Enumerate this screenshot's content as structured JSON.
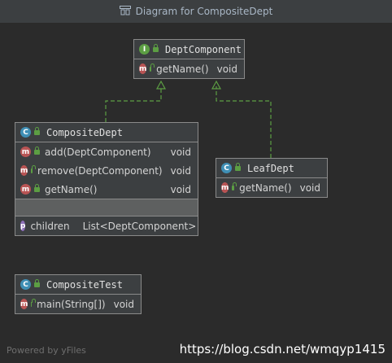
{
  "window": {
    "title": "Diagram for CompositeDept",
    "title_icon": "diagram-icon"
  },
  "nodes": {
    "dept_component": {
      "kind": "interface",
      "badge": "I",
      "name": "DeptComponent",
      "methods": [
        {
          "badge": "m",
          "name": "getName()",
          "type": "void"
        }
      ]
    },
    "composite_dept": {
      "kind": "class",
      "badge": "C",
      "name": "CompositeDept",
      "methods": [
        {
          "badge": "m",
          "name": "add(DeptComponent)",
          "type": "void"
        },
        {
          "badge": "m",
          "name": "remove(DeptComponent)",
          "type": "void"
        },
        {
          "badge": "m",
          "name": "getName()",
          "type": "void"
        }
      ],
      "properties": [
        {
          "badge": "p",
          "name": "children",
          "type": "List<DeptComponent>"
        }
      ]
    },
    "leaf_dept": {
      "kind": "class",
      "badge": "C",
      "name": "LeafDept",
      "methods": [
        {
          "badge": "m",
          "name": "getName()",
          "type": "void"
        }
      ]
    },
    "composite_test": {
      "kind": "class",
      "badge": "C",
      "name": "CompositeTest",
      "methods": [
        {
          "badge": "m",
          "name": "main(String[])",
          "type": "void"
        }
      ]
    }
  },
  "footer": {
    "powered_by": "Powered by yFiles",
    "watermark": "https://blog.csdn.net/wmqyp1415"
  },
  "colors": {
    "background": "#2b2b2b",
    "node_fill": "#3c3f41",
    "edge": "#5c9e43",
    "class_badge": "#3f8fb5",
    "interface_badge": "#5c9e43",
    "method_badge": "#b85454",
    "property_badge": "#8d6fb8"
  }
}
